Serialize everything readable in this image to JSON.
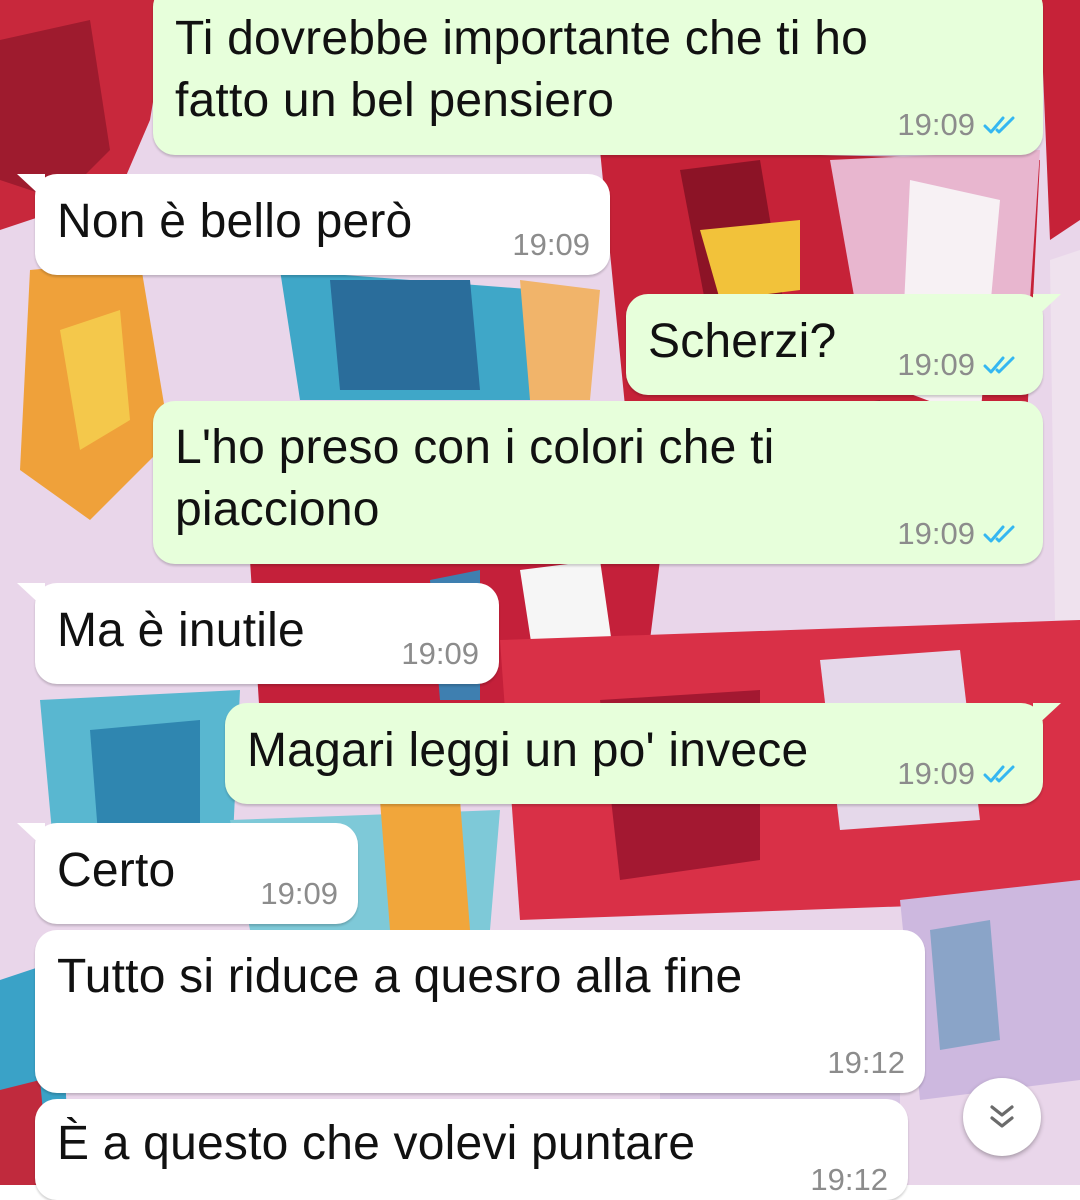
{
  "chat": {
    "wallpaper": "abstract-paint-wallpaper",
    "colors": {
      "outgoing_bubble": "#e7ffdb",
      "incoming_bubble": "#ffffff",
      "read_ticks": "#34b7f1",
      "timestamp": "#8c8c8c"
    },
    "messages": [
      {
        "direction": "out",
        "text": "Ti dovrebbe importante che ti ho\nfatto un bel pensiero",
        "time": "19:09",
        "status": "read"
      },
      {
        "direction": "in",
        "text": "Non è bello però",
        "time": "19:09"
      },
      {
        "direction": "out",
        "text": "Scherzi?",
        "time": "19:09",
        "status": "read"
      },
      {
        "direction": "out",
        "text": "L'ho preso con i colori che ti\npiacciono",
        "time": "19:09",
        "status": "read"
      },
      {
        "direction": "in",
        "text": "Ma è inutile",
        "time": "19:09"
      },
      {
        "direction": "out",
        "text": "Magari leggi un po' invece",
        "time": "19:09",
        "status": "read"
      },
      {
        "direction": "in",
        "text": "Certo",
        "time": "19:09"
      },
      {
        "direction": "in",
        "text": "Tutto si riduce a quesro alla fine",
        "time": "19:12"
      },
      {
        "direction": "in",
        "text": "È a questo che volevi puntare",
        "time": "19:12"
      }
    ],
    "scroll_down_icon": "double-chevron-down-icon"
  }
}
